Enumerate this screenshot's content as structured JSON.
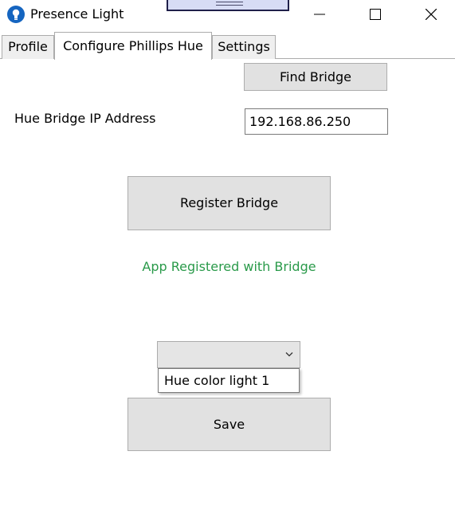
{
  "window": {
    "title": "Presence Light"
  },
  "tabs": [
    {
      "label": "Profile"
    },
    {
      "label": "Configure Phillips Hue"
    },
    {
      "label": "Settings"
    }
  ],
  "hue": {
    "find_bridge_label": "Find Bridge",
    "ip_label": "Hue Bridge IP Address",
    "ip_value": "192.168.86.250",
    "register_label": "Register Bridge",
    "status_text": "App Registered with Bridge",
    "light_select": {
      "selected": "",
      "options": [
        "Hue color light 1"
      ]
    },
    "save_label": "Save"
  },
  "colors": {
    "status_green": "#2a9a4a",
    "icon_blue": "#1565c0",
    "button_bg": "#e1e1e1"
  },
  "icons": {
    "app": "lightbulb-icon",
    "minimize": "minimize-icon",
    "maximize": "maximize-icon",
    "close": "close-icon",
    "dropdown": "chevron-down-icon"
  }
}
